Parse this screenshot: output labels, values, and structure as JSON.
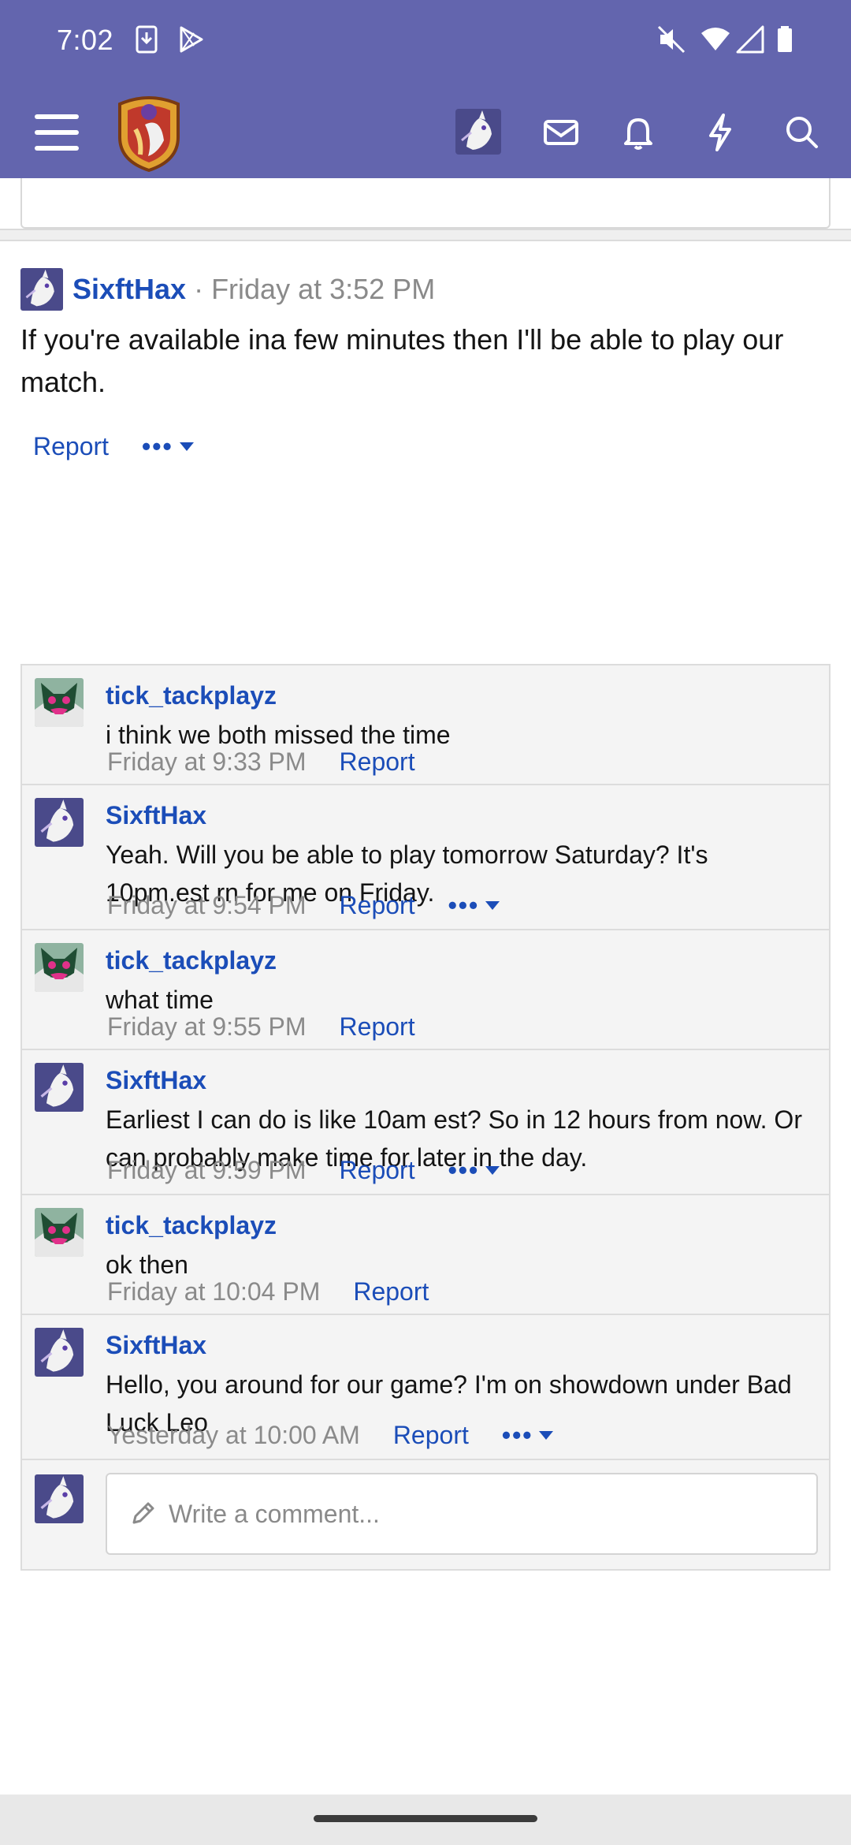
{
  "status_bar": {
    "time": "7:02",
    "icons": [
      "download-icon",
      "play-store-icon",
      "vibrate-off-icon",
      "wifi-icon",
      "signal-icon",
      "battery-icon"
    ]
  },
  "app_bar": {
    "icons": [
      "menu-icon",
      "site-logo",
      "user-avatar",
      "inbox-icon",
      "bell-icon",
      "bolt-icon",
      "search-icon"
    ],
    "accent_color": "#6365ae"
  },
  "post": {
    "author": "SixftHax",
    "separator": "·",
    "time": "Friday at 3:52 PM",
    "body": "If you're available ina few minutes then I'll be able to play our match.",
    "report": "Report",
    "more": "•••"
  },
  "comments": [
    {
      "author": "tick_tackplayz",
      "text": "i think we both missed the time",
      "time": "Friday at 9:33 PM",
      "report": "Report",
      "more": ""
    },
    {
      "author": "SixftHax",
      "text": "Yeah. Will you be able to play tomorrow Saturday? It's 10pm.est rn for me on Friday.",
      "time": "Friday at 9:54 PM",
      "report": "Report",
      "more": "•••"
    },
    {
      "author": "tick_tackplayz",
      "text": "what time",
      "time": "Friday at 9:55 PM",
      "report": "Report",
      "more": ""
    },
    {
      "author": "SixftHax",
      "text": "Earliest I can do is like 10am est? So in 12 hours from now. Or can probably make time for later in the day.",
      "time": "Friday at 9:59 PM",
      "report": "Report",
      "more": "•••"
    },
    {
      "author": "tick_tackplayz",
      "text": "ok then",
      "time": "Friday at 10:04 PM",
      "report": "Report",
      "more": ""
    },
    {
      "author": "SixftHax",
      "text": "Hello, you around for our game? I'm on showdown under Bad Luck Leo",
      "time": "Yesterday at 10:00 AM",
      "report": "Report",
      "more": "•••"
    }
  ],
  "write_comment": {
    "placeholder": "Write a comment..."
  },
  "colors": {
    "link": "#1b4db8",
    "muted": "#8a8a8a"
  }
}
